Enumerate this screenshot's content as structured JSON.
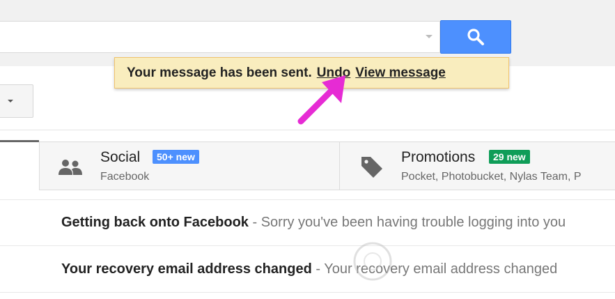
{
  "search": {
    "value": "",
    "button_icon": "search-icon"
  },
  "notice": {
    "message": "Your message has been sent.",
    "undo_label": "Undo",
    "view_label": "View message"
  },
  "tabs": [
    {
      "id": "social",
      "title": "Social",
      "badge": "50+ new",
      "badge_color": "#4d90fe",
      "senders": "Facebook",
      "icon": "people-icon"
    },
    {
      "id": "promotions",
      "title": "Promotions",
      "badge": "29 new",
      "badge_color": "#0f9d58",
      "senders": "Pocket, Photobucket, Nylas Team, P",
      "icon": "tag-icon"
    }
  ],
  "emails": [
    {
      "subject": "Getting back onto Facebook",
      "snippet": " - Sorry you've been having trouble logging into you"
    },
    {
      "subject": "Your recovery email address changed",
      "snippet": " - Your recovery email address changed"
    }
  ],
  "colors": {
    "accent": "#4d90fe",
    "notice_bg": "#f9edbe",
    "arrow": "#e62bd4"
  }
}
